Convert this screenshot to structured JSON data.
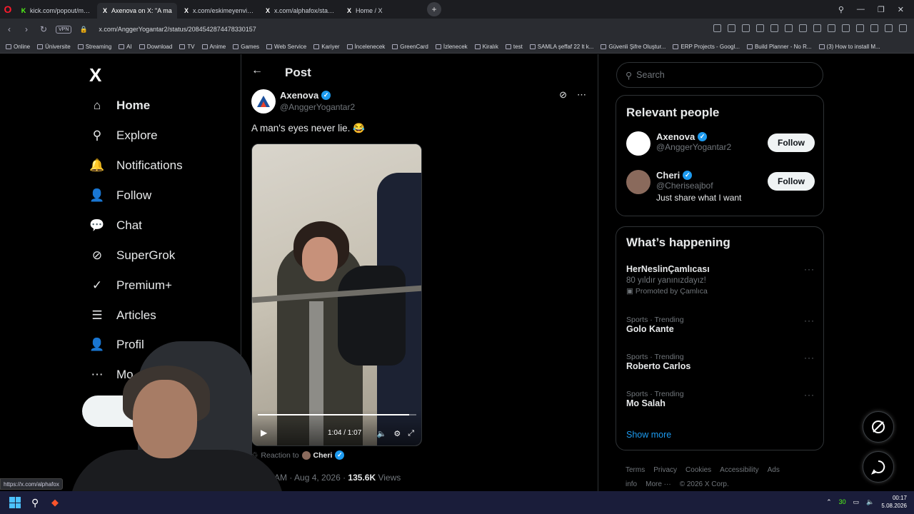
{
  "browser": {
    "tabs": [
      {
        "label": "kick.com/popout/mehme",
        "favicon": "K",
        "fav_color": "#53fc18",
        "active": false
      },
      {
        "label": "Axenova on X: \"A ma",
        "favicon": "X",
        "fav_color": "#ffffff",
        "active": true
      },
      {
        "label": "x.com/eskimeyenvideo/st",
        "favicon": "X",
        "fav_color": "#ffffff",
        "active": false
      },
      {
        "label": "x.com/alphafox/status/20",
        "favicon": "X",
        "fav_color": "#ffffff",
        "active": false
      },
      {
        "label": "Home / X",
        "favicon": "X",
        "fav_color": "#ffffff",
        "active": false
      }
    ],
    "new_tab": "+",
    "vpn_label": "VPN",
    "url": "x.com/AnggerYogantar2/status/2084542874478330157",
    "bookmarks": [
      "Online",
      "Üniversite",
      "Streaming",
      "AI",
      "Download",
      "TV",
      "Anime",
      "Games",
      "Web Service",
      "Kariyer",
      "İncelenecek",
      "GreenCard",
      "İzlenecek",
      "Kiralık",
      "test",
      "SAMLA şeffaf 22 lt k...",
      "Güvenli Şifre Oluştur...",
      "ERP Projects - Googl...",
      "Build Planner - No R...",
      "(3) How to install M..."
    ]
  },
  "leftnav": {
    "logo": "X",
    "items": [
      {
        "label": "Home",
        "icon": "home-icon",
        "glyph": "⌂"
      },
      {
        "label": "Explore",
        "icon": "search-icon",
        "glyph": "⚲"
      },
      {
        "label": "Notifications",
        "icon": "bell-icon",
        "glyph": "🔔"
      },
      {
        "label": "Follow",
        "icon": "add-person-icon",
        "glyph": "👤"
      },
      {
        "label": "Chat",
        "icon": "chat-bubble-icon",
        "glyph": "💬"
      },
      {
        "label": "SuperGrok",
        "icon": "grok-icon",
        "glyph": "⊘"
      },
      {
        "label": "Premium+",
        "icon": "premium-check-icon",
        "glyph": "✓"
      },
      {
        "label": "Articles",
        "icon": "articles-icon",
        "glyph": "☰"
      },
      {
        "label": "Profil",
        "icon": "profile-icon",
        "glyph": "👤"
      },
      {
        "label": "Mo",
        "icon": "more-icon",
        "glyph": "⋯"
      }
    ]
  },
  "post": {
    "header_title": "Post",
    "author_name": "Axenova",
    "author_handle": "@AnggerYogantar2",
    "text": "A man's eyes never lie. 😂",
    "video": {
      "time": "1:04 / 1:07",
      "progress": 0.955
    },
    "reaction_prefix": "Reaction to",
    "reaction_name": "Cheri",
    "meta_time": "32 AM · Aug 4, 2026 · ",
    "meta_views_count": "135.6K",
    "meta_views_label": " Views"
  },
  "sidebar": {
    "search_placeholder": "Search",
    "relevant_title": "Relevant people",
    "people": [
      {
        "name": "Axenova",
        "handle": "@AnggerYogantar2",
        "bio": "",
        "follow": "Follow",
        "avatar_color": "#ffffff"
      },
      {
        "name": "Cheri",
        "handle": "@Cheriseajbof",
        "bio": "Just share what I want",
        "follow": "Follow",
        "avatar_color": "#8a6a5c"
      }
    ],
    "happening_title": "What’s happening",
    "trends": [
      {
        "context": "",
        "title": "HerNeslinÇamlıcası",
        "line1": "80 yıldır yanınızdayız!",
        "line2": "Promoted by Çamlıca"
      },
      {
        "context": "Sports · Trending",
        "title": "Golo Kante",
        "line1": "",
        "line2": ""
      },
      {
        "context": "Sports · Trending",
        "title": "Roberto Carlos",
        "line1": "",
        "line2": ""
      },
      {
        "context": "Sports · Trending",
        "title": "Mo Salah",
        "line1": "",
        "line2": ""
      }
    ],
    "show_more": "Show more",
    "footer": [
      "Terms",
      "Privacy",
      "Cookies",
      "Accessibility",
      "Ads info",
      "More ···",
      "© 2026 X Corp."
    ]
  },
  "status_url": "https://x.com/alphafox",
  "taskbar": {
    "clock_time": "00:17",
    "clock_date": "5.08.2026",
    "tray_badge": "30"
  },
  "colors": {
    "accent": "#1d9bf0",
    "background": "#000000",
    "border": "#2f3336",
    "muted": "#71767b"
  }
}
